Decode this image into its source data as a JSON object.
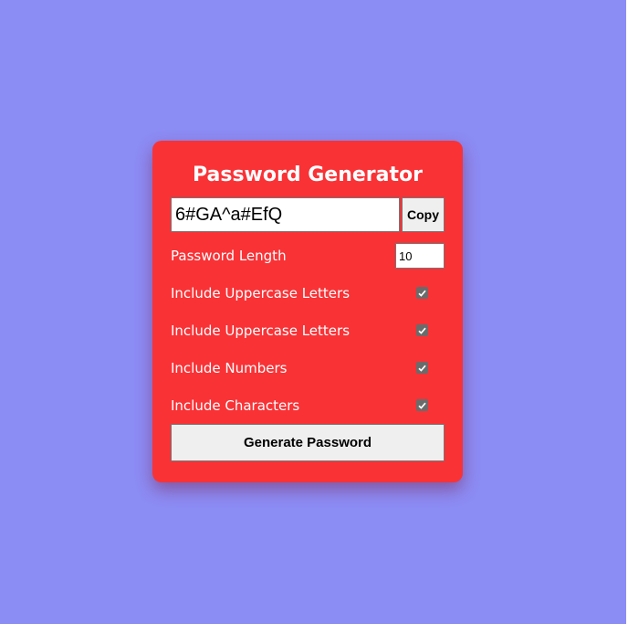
{
  "colors": {
    "page_background": "#8c8cf5",
    "card_background": "#f93236",
    "button_background": "#efefef",
    "text_on_card": "#ffffff"
  },
  "generator": {
    "title": "Password Generator",
    "password_value": "6#GA^a#EfQ",
    "copy_label": "Copy",
    "length_label": "Password Length",
    "length_value": "10",
    "options": [
      {
        "label": "Include Uppercase Letters",
        "checked": true
      },
      {
        "label": "Include Uppercase Letters",
        "checked": true
      },
      {
        "label": "Include Numbers",
        "checked": true
      },
      {
        "label": "Include Characters",
        "checked": true
      }
    ],
    "generate_label": "Generate Password"
  }
}
